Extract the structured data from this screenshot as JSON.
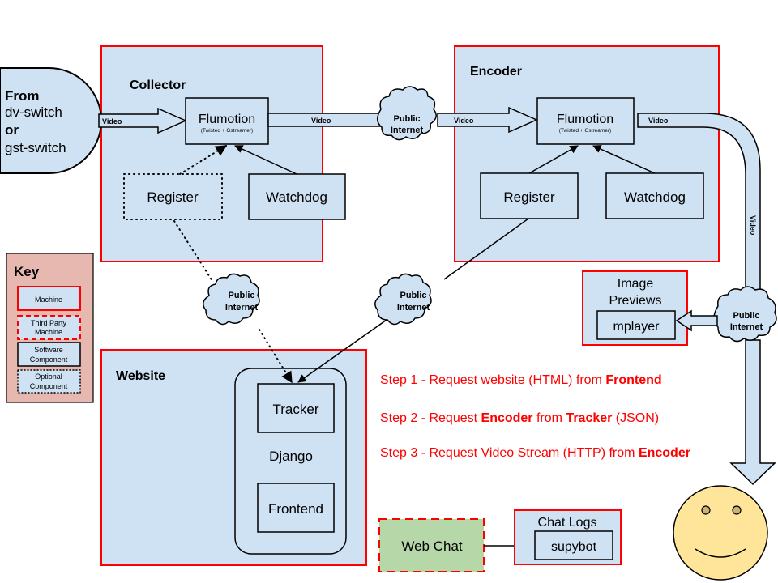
{
  "colors": {
    "machine_fill": "#cfe2f3",
    "machine_border": "#ff0000",
    "key_fill": "#e6b8af",
    "webchat_fill": "#b6d7a8",
    "face_fill": "#ffe599",
    "eye_fill": "#c9b37a",
    "steps_text": "#ff0000"
  },
  "source": {
    "line1": "From",
    "line2": "dv-switch",
    "line3": "or",
    "line4": "gst-switch"
  },
  "collector": {
    "title": "Collector",
    "flumotion": "Flumotion",
    "flumotion_sub": "(Twisted + Gstreamer)",
    "register": "Register",
    "watchdog": "Watchdog"
  },
  "encoder": {
    "title": "Encoder",
    "flumotion": "Flumotion",
    "flumotion_sub": "(Twisted + Gstreamer)",
    "register": "Register",
    "watchdog": "Watchdog"
  },
  "arrows": {
    "video_in": "Video",
    "video_collector_out": "Video",
    "video_encoder_in": "Video",
    "video_encoder_out": "Video",
    "video_down": "Video"
  },
  "clouds": {
    "c1": {
      "l1": "Public",
      "l2": "Internet"
    },
    "c2": {
      "l1": "Public",
      "l2": "Internet"
    },
    "c3": {
      "l1": "Public",
      "l2": "Internet"
    },
    "c4": {
      "l1": "Public",
      "l2": "Internet"
    }
  },
  "key": {
    "title": "Key",
    "machine": "Machine",
    "third_party_l1": "Third Party",
    "third_party_l2": "Machine",
    "software_l1": "Software",
    "software_l2": "Component",
    "optional_l1": "Optional",
    "optional_l2": "Component"
  },
  "website": {
    "title": "Website",
    "tracker": "Tracker",
    "django": "Django",
    "frontend": "Frontend"
  },
  "previews": {
    "title_l1": "Image",
    "title_l2": "Previews",
    "mplayer": "mplayer"
  },
  "steps": [
    {
      "a": "Step 1 - Request website (HTML) from ",
      "b": "Frontend",
      "c": "",
      "d": "",
      "e": ""
    },
    {
      "a": "Step 2 - Request ",
      "b": "Encoder",
      "c": " from ",
      "d": "Tracker",
      "e": " (JSON)"
    },
    {
      "a": "Step 3 - Request Video Stream (HTTP) from ",
      "b": "Encoder",
      "c": "",
      "d": "",
      "e": ""
    }
  ],
  "chat": {
    "webchat": "Web Chat",
    "logs_title": "Chat Logs",
    "supybot": "supybot"
  }
}
